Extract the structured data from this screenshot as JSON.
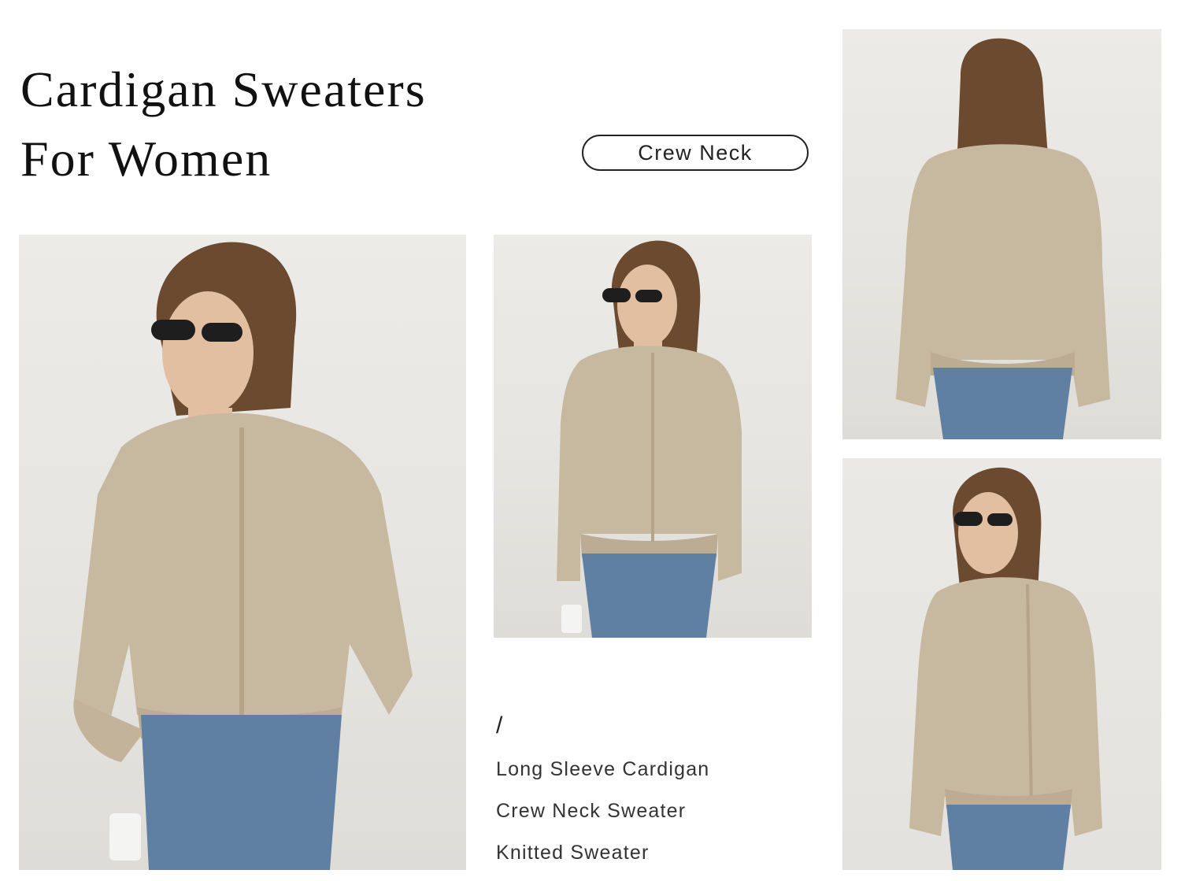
{
  "header": {
    "title_line1": "Cardigan Sweaters",
    "title_line2": "For Women"
  },
  "badge": {
    "label": "Crew Neck"
  },
  "separator": "/",
  "tags": [
    "Long Sleeve Cardigan",
    "Crew Neck Sweater",
    "Knitted Sweater"
  ],
  "colors": {
    "sweater": "#c7b8a0",
    "jeans": "#5f7fa3",
    "hair": "#6b4a2f",
    "skin": "#e3bfa2",
    "backdrop": "#e8e6e2"
  }
}
